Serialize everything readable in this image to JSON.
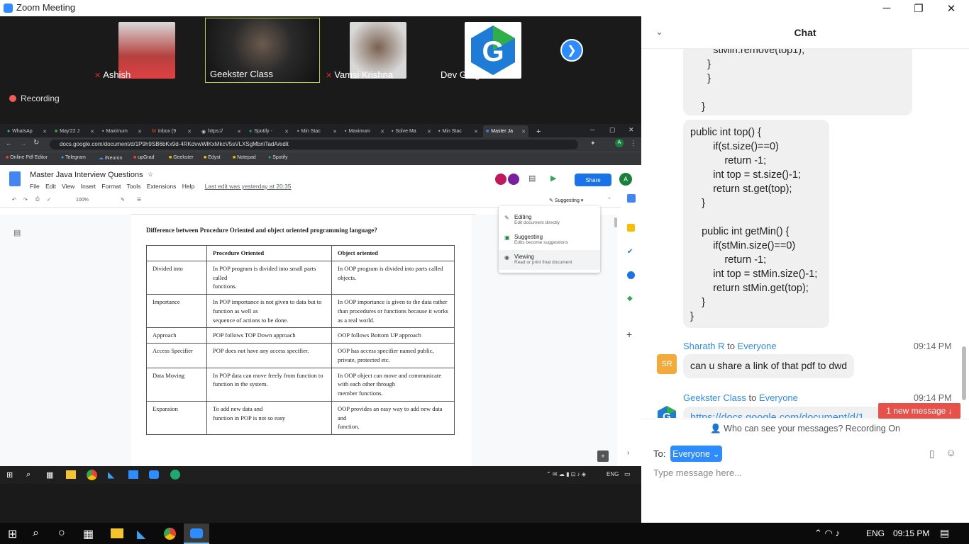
{
  "window": {
    "title": "Zoom Meeting"
  },
  "participants": [
    {
      "name": "Ashish",
      "muted": true,
      "color": "#c8353a"
    },
    {
      "name": "Geekster Class",
      "muted": false,
      "color": "#3b3b3b"
    },
    {
      "name": "Vamsi Krishna",
      "muted": true,
      "color": "#6b5b4a"
    },
    {
      "name": "Dev Garg",
      "muted": false,
      "color": "#fff"
    }
  ],
  "recording_label": "Recording",
  "browser": {
    "tabs": [
      "WhatsAp",
      "May'22 J",
      "Maximum",
      "Inbox (9",
      "https://",
      "Spotify -",
      "Min Stac",
      "Maximum",
      "Solve Ma",
      "Min Stac",
      "Master Ja"
    ],
    "url": "docs.google.com/document/d/1P9h9SB6bKx9d-4RKdvwWlKxMkcV5sVLXSgMbriiTadA/edit",
    "bookmarks": [
      "Online Pdf Editor",
      "Telegram",
      "iNeuron",
      "upGrad",
      "Geekster",
      "Edyst",
      "Notepad",
      "Spotify"
    ]
  },
  "doc": {
    "title": "Master Java Interview Questions",
    "menu": [
      "File",
      "Edit",
      "View",
      "Insert",
      "Format",
      "Tools",
      "Extensions",
      "Help"
    ],
    "last_edit": "Last edit was yesterday at 20:35",
    "share_label": "Share",
    "zoom": "100%",
    "mode_label": "Suggesting",
    "heading": "Difference between Procedure Oriented and object oriented programming language?",
    "table": {
      "headers": [
        "",
        "Procedure Oriented",
        "Object oriented"
      ],
      "rows": [
        [
          "Divided into",
          "In POP program is divided  into small parts called\nfunctions.",
          "In OOP program is divided  into parts called objects."
        ],
        [
          "Importance",
          "In POP importance is not  given to data but to\nfunction as well as\nsequence of actions to be  done.",
          "In OOP importance is given  to the data rather than  procedures or functions  because it works as a real world."
        ],
        [
          "Approach",
          "POP follows TOP Down  approach",
          "OOP follows Bottom UP  approach"
        ],
        [
          "Access Specifier",
          "POP does not have any  access specifier.",
          "OOP has access specifier  named public, private,  protected etc."
        ],
        [
          "Data Moving",
          "In POP data can move  freely from function to  function in the system.",
          "In OOP object can move  and communicate with  each other through\nmember functions."
        ],
        [
          "Expansion",
          "To add new data and\nfunction in POP is not so  easy",
          "OOP provides an easy way  to add new data and\nfunction."
        ]
      ]
    },
    "modes": [
      {
        "label": "Editing",
        "desc": "Edit document directly",
        "icon": "pencil-icon"
      },
      {
        "label": "Suggesting",
        "desc": "Edits become suggestions",
        "icon": "suggest-icon"
      },
      {
        "label": "Viewing",
        "desc": "Read or print final document",
        "icon": "eye-icon"
      }
    ]
  },
  "inner_taskbar": {
    "lang": "ENG"
  },
  "chat": {
    "title": "Chat",
    "code_top": "        stMin.remove(top1);\n      }\n      }\n\n    }",
    "code_main": "public int top() {\n        if(st.size()==0)\n            return -1;\n        int top = st.size()-1;\n        return st.get(top);\n    }\n\n    public int getMin() {\n        if(stMin.size()==0)\n            return -1;\n        int top = stMin.size()-1;\n        return stMin.get(top);\n    }\n}",
    "messages": [
      {
        "initials": "SR",
        "sender": "Sharath R",
        "to_word": "to",
        "to": "Everyone",
        "time": "09:14 PM",
        "text": "can u share a link of that pdf to dwd"
      },
      {
        "sender": "Geekster Class",
        "to_word": "to",
        "to": "Everyone",
        "time": "09:14 PM",
        "text": "https://docs.google.com/document/d/1"
      }
    ],
    "new_message": "1 new message ↓",
    "who_can_see": "Who can see your messages? Recording On",
    "to_label": "To:",
    "recipient": "Everyone",
    "placeholder": "Type message here..."
  },
  "system_tray": {
    "lang": "ENG",
    "time": "09:15 PM"
  }
}
